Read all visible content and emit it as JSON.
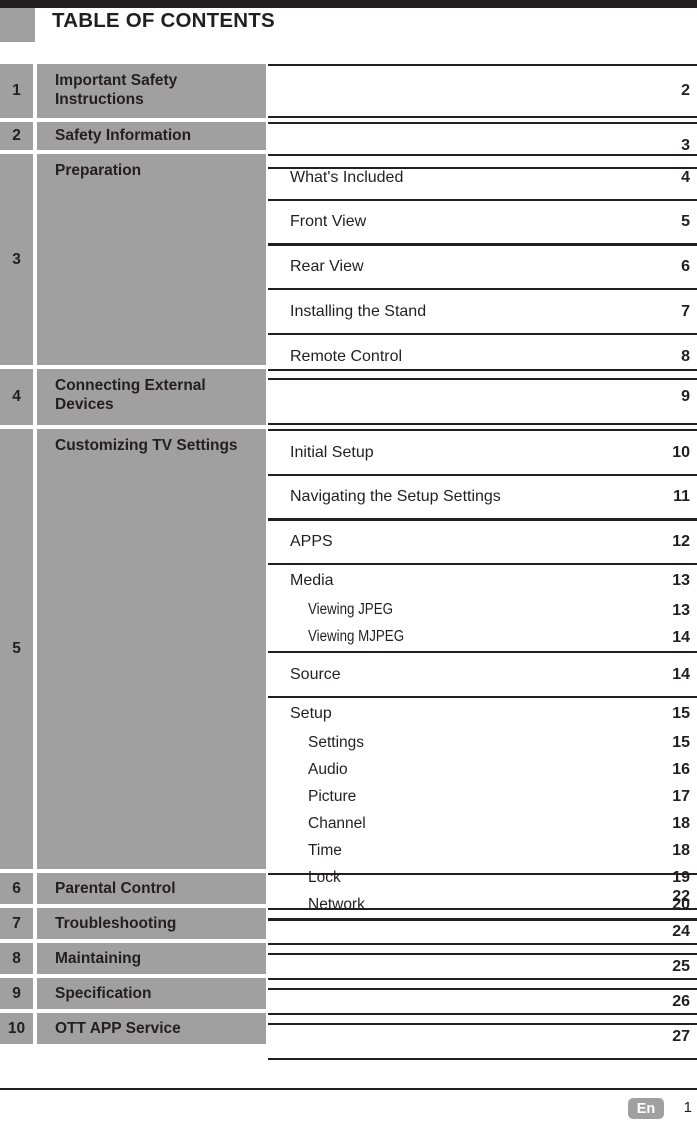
{
  "header": {
    "title": "TABLE OF CONTENTS",
    "swatch_color": "#a0a0a0",
    "bar_color": "#231f20"
  },
  "toc": {
    "sections": [
      {
        "number": "1",
        "title": "Important Safety Instructions",
        "page": "2",
        "entries": []
      },
      {
        "number": "2",
        "title": "Safety Information",
        "page": "3",
        "entries": []
      },
      {
        "number": "3",
        "title": "Preparation",
        "page": "",
        "entries": [
          {
            "label": "What's Included",
            "page": "4",
            "children": []
          },
          {
            "label": "Front View",
            "page": "5",
            "children": []
          },
          {
            "label": "Rear View",
            "page": "6",
            "children": []
          },
          {
            "label": "Installing the Stand",
            "page": "7",
            "children": []
          },
          {
            "label": "Remote Control",
            "page": "8",
            "children": []
          }
        ]
      },
      {
        "number": "4",
        "title": "Connecting External Devices",
        "page": "9",
        "entries": []
      },
      {
        "number": "5",
        "title": "Customizing TV Settings",
        "page": "",
        "entries": [
          {
            "label": "Initial Setup",
            "page": "10",
            "children": []
          },
          {
            "label": "Navigating the Setup Settings",
            "page": "11",
            "children": []
          },
          {
            "label": "APPS",
            "page": "12",
            "children": []
          },
          {
            "label": "Media",
            "page": "13",
            "children": [
              {
                "label": "Viewing JPEG",
                "page": "13",
                "condensed": true
              },
              {
                "label": "Viewing MJPEG",
                "page": "14",
                "condensed": true
              }
            ]
          },
          {
            "label": "Source",
            "page": "14",
            "children": []
          },
          {
            "label": "Setup",
            "page": "15",
            "children": [
              {
                "label": "Settings",
                "page": "15",
                "condensed": false
              },
              {
                "label": "Audio",
                "page": "16",
                "condensed": false
              },
              {
                "label": "Picture",
                "page": "17",
                "condensed": false
              },
              {
                "label": "Channel",
                "page": "18",
                "condensed": false
              },
              {
                "label": "Time",
                "page": "18",
                "condensed": false
              },
              {
                "label": "Lock",
                "page": "19",
                "condensed": false
              },
              {
                "label": "Network",
                "page": "20",
                "condensed": false
              }
            ]
          }
        ]
      },
      {
        "number": "6",
        "title": "Parental Control",
        "page": "22",
        "entries": []
      },
      {
        "number": "7",
        "title": "Troubleshooting",
        "page": "24",
        "entries": []
      },
      {
        "number": "8",
        "title": "Maintaining",
        "page": "25",
        "entries": []
      },
      {
        "number": "9",
        "title": "Specification",
        "page": "26",
        "entries": []
      },
      {
        "number": "10",
        "title": "OTT APP Service",
        "page": "27",
        "entries": []
      }
    ]
  },
  "footer": {
    "language_badge": "En",
    "page_number": "1"
  }
}
